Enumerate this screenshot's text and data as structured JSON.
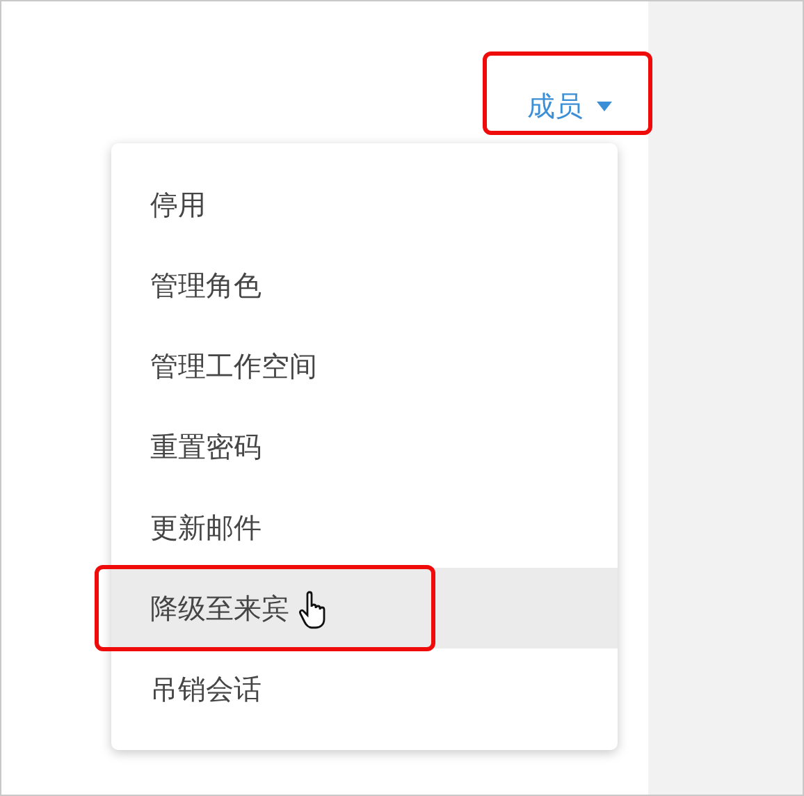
{
  "trigger": {
    "label": "成员",
    "expanded": true
  },
  "menu": {
    "items": [
      {
        "label": "停用",
        "selected": false
      },
      {
        "label": "管理角色",
        "selected": false
      },
      {
        "label": "管理工作空间",
        "selected": false
      },
      {
        "label": "重置密码",
        "selected": false
      },
      {
        "label": "更新邮件",
        "selected": false
      },
      {
        "label": "降级至来宾",
        "selected": true
      },
      {
        "label": "吊销会话",
        "selected": false
      }
    ]
  }
}
